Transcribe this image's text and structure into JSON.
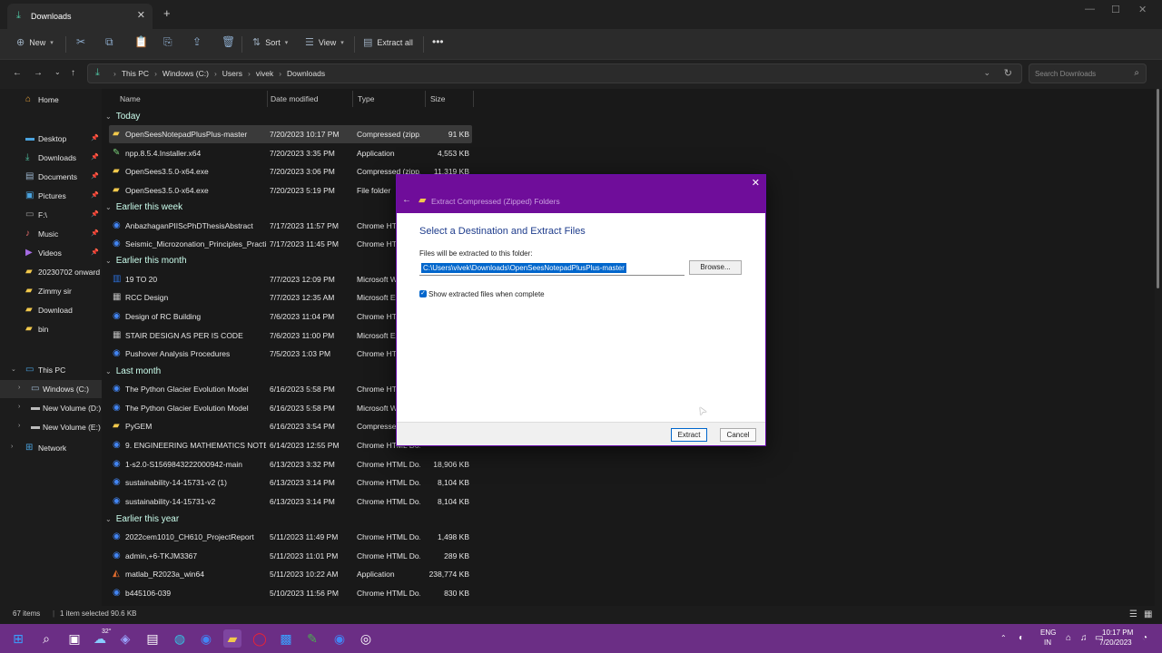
{
  "tab": {
    "title": "Downloads"
  },
  "commandbar": {
    "new": "New",
    "sort": "Sort",
    "view": "View",
    "extract_all": "Extract all"
  },
  "address": {
    "crumbs": [
      "This PC",
      "Windows (C:)",
      "Users",
      "vivek",
      "Downloads"
    ]
  },
  "search": {
    "placeholder": "Search Downloads"
  },
  "sidebar": {
    "items": [
      {
        "label": "Home",
        "icon": "home-icon"
      },
      {
        "label": "Desktop",
        "icon": "desktop-icon",
        "pinned": true
      },
      {
        "label": "Downloads",
        "icon": "download-icon",
        "pinned": true
      },
      {
        "label": "Documents",
        "icon": "document-icon",
        "pinned": true
      },
      {
        "label": "Pictures",
        "icon": "pictures-icon",
        "pinned": true
      },
      {
        "label": "F:\\",
        "icon": "drive-icon",
        "pinned": true
      },
      {
        "label": "Music",
        "icon": "music-icon",
        "pinned": true
      },
      {
        "label": "Videos",
        "icon": "videos-icon",
        "pinned": true
      },
      {
        "label": "20230702 onward",
        "icon": "folder-icon"
      },
      {
        "label": "Zimmy sir",
        "icon": "folder-icon"
      },
      {
        "label": "Download",
        "icon": "folder-icon"
      },
      {
        "label": "bin",
        "icon": "folder-icon"
      },
      {
        "label": "This PC",
        "icon": "pc-icon"
      },
      {
        "label": "Windows (C:)",
        "icon": "drive-icon"
      },
      {
        "label": "New Volume (D:)",
        "icon": "drive-icon"
      },
      {
        "label": "New Volume (E:)",
        "icon": "drive-icon"
      },
      {
        "label": "Network",
        "icon": "network-icon"
      }
    ]
  },
  "columns": {
    "name": "Name",
    "date": "Date modified",
    "type": "Type",
    "size": "Size"
  },
  "groups": {
    "today": "Today",
    "this_week": "Earlier this week",
    "this_month": "Earlier this month",
    "last_month": "Last month",
    "this_year": "Earlier this year"
  },
  "files": [
    {
      "name": "OpenSeesNotepadPlusPlus-master",
      "date": "7/20/2023 10:17 PM",
      "type": "Compressed (zipp...",
      "size": "91 KB",
      "icon": "zip"
    },
    {
      "name": "npp.8.5.4.Installer.x64",
      "date": "7/20/2023 3:35 PM",
      "type": "Application",
      "size": "4,553 KB",
      "icon": "app"
    },
    {
      "name": "OpenSees3.5.0-x64.exe",
      "date": "7/20/2023 3:06 PM",
      "type": "Compressed (zipp...",
      "size": "11,319 KB",
      "icon": "zip"
    },
    {
      "name": "OpenSees3.5.0-x64.exe",
      "date": "7/20/2023 5:19 PM",
      "type": "File folder",
      "size": "",
      "icon": "folder"
    },
    {
      "name": "AnbazhaganPIIScPhDThesisAbstract",
      "date": "7/17/2023 11:57 PM",
      "type": "Chrome HTML Do...",
      "size": "",
      "icon": "chrome"
    },
    {
      "name": "Seismic_Microzonation_Principles_Practi...",
      "date": "7/17/2023 11:45 PM",
      "type": "Chrome HTML Do...",
      "size": "",
      "icon": "chrome"
    },
    {
      "name": "19 TO 20",
      "date": "7/7/2023 12:09 PM",
      "type": "Microsoft Word...",
      "size": "",
      "icon": "word"
    },
    {
      "name": "RCC Design",
      "date": "7/7/2023 12:35 AM",
      "type": "Microsoft Excel...",
      "size": "",
      "icon": "excel"
    },
    {
      "name": "Design of RC Building",
      "date": "7/6/2023 11:04 PM",
      "type": "Chrome HTML Do...",
      "size": "",
      "icon": "chrome"
    },
    {
      "name": "STAIR DESIGN AS PER IS CODE",
      "date": "7/6/2023 11:00 PM",
      "type": "Microsoft Excel...",
      "size": "",
      "icon": "excel"
    },
    {
      "name": "Pushover Analysis Procedures",
      "date": "7/5/2023 1:03 PM",
      "type": "Chrome HTML Do...",
      "size": "",
      "icon": "chrome"
    },
    {
      "name": "The Python Glacier Evolution Model",
      "date": "6/16/2023 5:58 PM",
      "type": "Chrome HTML Do...",
      "size": "",
      "icon": "chrome"
    },
    {
      "name": "The Python Glacier Evolution Model",
      "date": "6/16/2023 5:58 PM",
      "type": "Microsoft Word...",
      "size": "",
      "icon": "chrome"
    },
    {
      "name": "PyGEM",
      "date": "6/16/2023 3:54 PM",
      "type": "Compressed (zipp...",
      "size": "",
      "icon": "folder"
    },
    {
      "name": "9. ENGINEERING MATHEMATICS NOTES",
      "date": "6/14/2023 12:55 PM",
      "type": "Chrome HTML Do...",
      "size": "",
      "icon": "chrome"
    },
    {
      "name": "1-s2.0-S1569843222000942-main",
      "date": "6/13/2023 3:32 PM",
      "type": "Chrome HTML Do...",
      "size": "18,906 KB",
      "icon": "chrome"
    },
    {
      "name": "sustainability-14-15731-v2 (1)",
      "date": "6/13/2023 3:14 PM",
      "type": "Chrome HTML Do...",
      "size": "8,104 KB",
      "icon": "chrome"
    },
    {
      "name": "sustainability-14-15731-v2",
      "date": "6/13/2023 3:14 PM",
      "type": "Chrome HTML Do...",
      "size": "8,104 KB",
      "icon": "chrome"
    },
    {
      "name": "2022cem1010_CH610_ProjectReport",
      "date": "5/11/2023 11:49 PM",
      "type": "Chrome HTML Do...",
      "size": "1,498 KB",
      "icon": "chrome"
    },
    {
      "name": "admin,+6-TKJM3367",
      "date": "5/11/2023 11:01 PM",
      "type": "Chrome HTML Do...",
      "size": "289 KB",
      "icon": "chrome"
    },
    {
      "name": "matlab_R2023a_win64",
      "date": "5/11/2023 10:22 AM",
      "type": "Application",
      "size": "238,774 KB",
      "icon": "matlab"
    },
    {
      "name": "b445106-039",
      "date": "5/10/2023 11:56 PM",
      "type": "Chrome HTML Do...",
      "size": "830 KB",
      "icon": "chrome"
    }
  ],
  "status": {
    "items": "67 items",
    "selected": "1 item selected  90.6 KB"
  },
  "dialog": {
    "title": "Extract Compressed (Zipped) Folders",
    "heading": "Select a Destination and Extract Files",
    "label": "Files will be extracted to this folder:",
    "path": "C:\\Users\\vivek\\Downloads\\OpenSeesNotepadPlusPlus-master",
    "browse": "Browse...",
    "checkbox_label": "Show extracted files when complete",
    "extract": "Extract",
    "cancel": "Cancel"
  },
  "taskbar": {
    "lang": "ENG",
    "region": "IN",
    "time": "10:17 PM",
    "date": "7/20/2023",
    "weather": "32°"
  },
  "colors": {
    "accent": "#6f0d9a",
    "taskbar": "#6b2e85"
  }
}
